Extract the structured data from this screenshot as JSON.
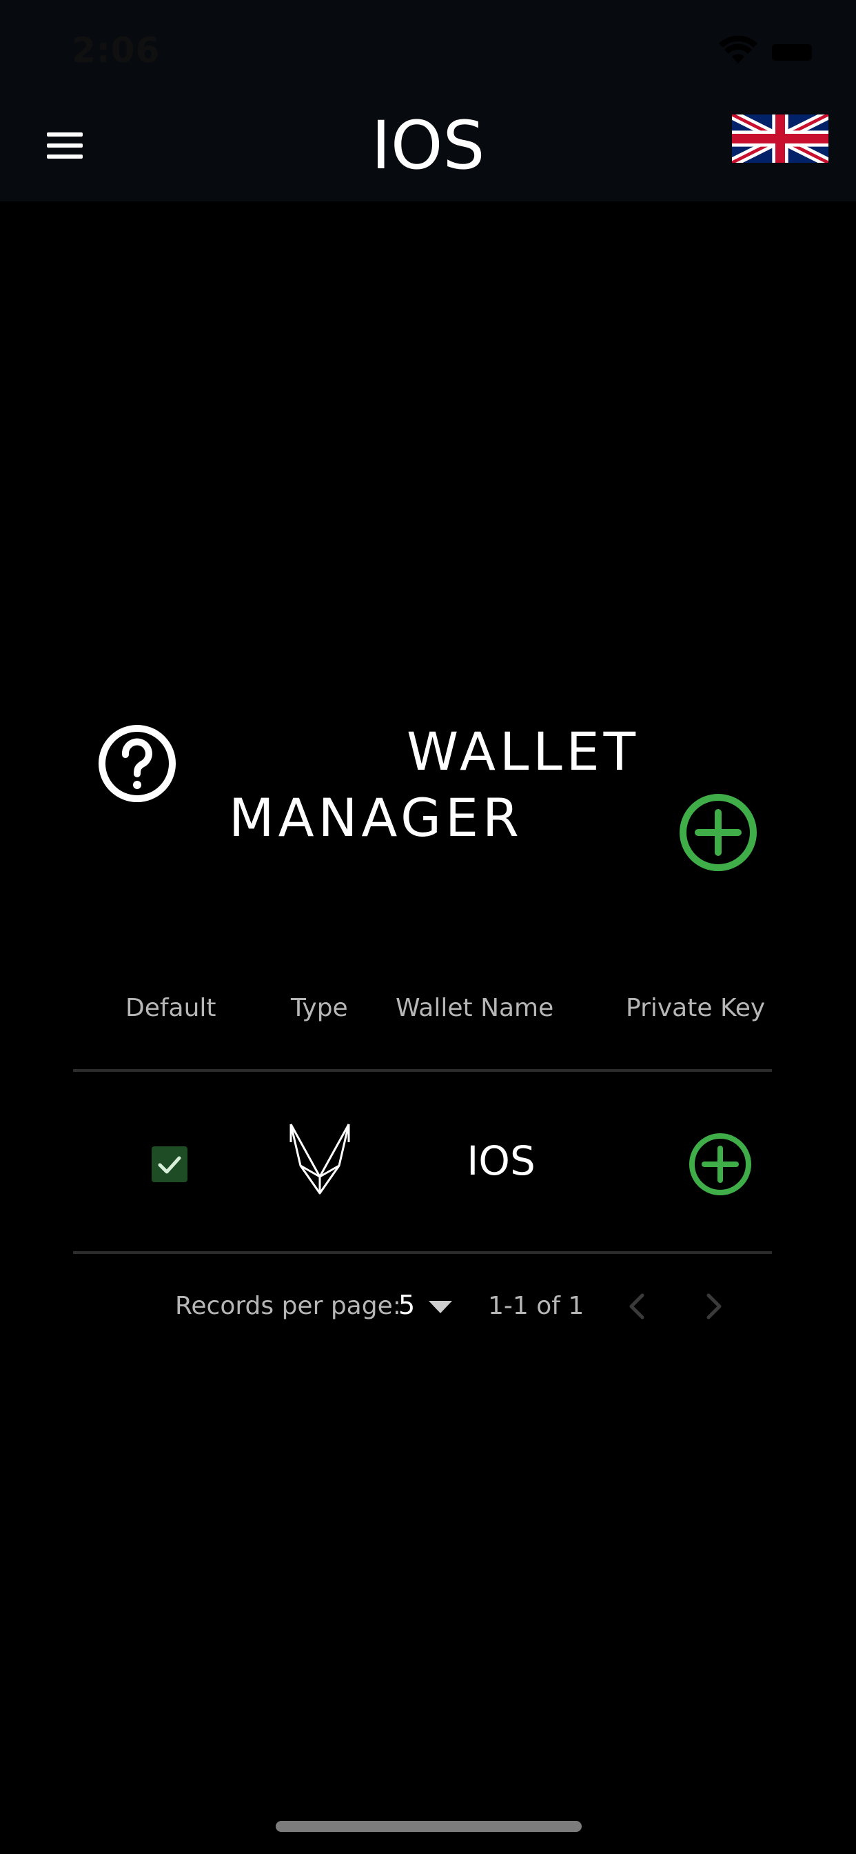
{
  "status_bar": {
    "time": "2:06"
  },
  "header": {
    "title": "IOS",
    "menu_icon": "hamburger-menu-icon",
    "language_icon": "uk-flag-icon"
  },
  "wallet_manager": {
    "title_line1": "WALLET",
    "title_line2": "MANAGER",
    "help_icon": "question-circle-icon",
    "add_icon": "plus-circle-icon"
  },
  "table": {
    "columns": [
      "Default",
      "Type",
      "Wallet Name",
      "Private Key"
    ],
    "rows": [
      {
        "default_checked": true,
        "type_icon": "wallet-type-logo",
        "wallet_name": "IOS",
        "private_key_icon": "plus-circle-icon"
      }
    ]
  },
  "pagination": {
    "records_per_page_label": "Records per page:",
    "records_per_page_value": "5",
    "range_text": "1-1 of 1"
  },
  "colors": {
    "accent_green": "#3fae49",
    "checkbox_green": "#1e4d25",
    "header_bg": "#070a0f",
    "page_bg": "#000000"
  }
}
